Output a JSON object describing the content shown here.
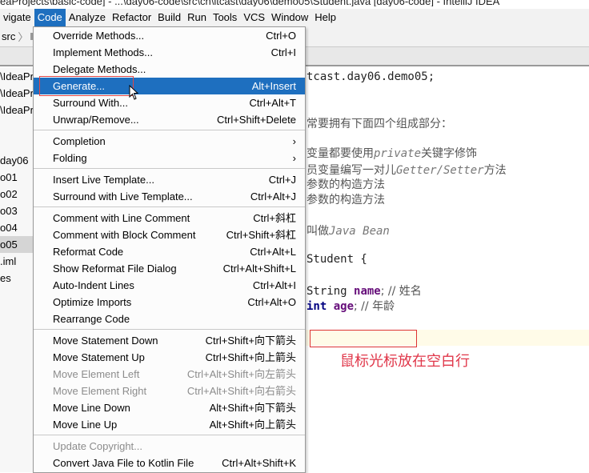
{
  "window_title": "eaProjects\\basic-code] - ...\\day06-code\\src\\cn\\itcast\\day06\\demo05\\Student.java [day06-code] - IntelliJ IDEA",
  "menubar": [
    "vigate",
    "Code",
    "Analyze",
    "Refactor",
    "Build",
    "Run",
    "Tools",
    "VCS",
    "Window",
    "Help"
  ],
  "navbar": {
    "crumb": "src"
  },
  "tree": [
    "\\IdeaPr",
    "\\IdeaPr",
    "\\IdeaPr",
    "",
    "",
    "day06",
    "o01",
    "o02",
    "o03",
    "o04",
    "o05",
    ".iml",
    "es"
  ],
  "menu": [
    {
      "label": "Override Methods...",
      "shortcut": "Ctrl+O"
    },
    {
      "label": "Implement Methods...",
      "shortcut": "Ctrl+I"
    },
    {
      "label": "Delegate Methods...",
      "shortcut": ""
    },
    {
      "label": "Generate...",
      "shortcut": "Alt+Insert",
      "highlighted": true
    },
    {
      "label": "Surround With...",
      "shortcut": "Ctrl+Alt+T"
    },
    {
      "label": "Unwrap/Remove...",
      "shortcut": "Ctrl+Shift+Delete"
    },
    {
      "sep": true
    },
    {
      "label": "Completion",
      "shortcut": "›"
    },
    {
      "label": "Folding",
      "shortcut": "›"
    },
    {
      "sep": true
    },
    {
      "label": "Insert Live Template...",
      "shortcut": "Ctrl+J"
    },
    {
      "label": "Surround with Live Template...",
      "shortcut": "Ctrl+Alt+J"
    },
    {
      "sep": true
    },
    {
      "label": "Comment with Line Comment",
      "shortcut": "Ctrl+斜杠"
    },
    {
      "label": "Comment with Block Comment",
      "shortcut": "Ctrl+Shift+斜杠"
    },
    {
      "label": "Reformat Code",
      "shortcut": "Ctrl+Alt+L"
    },
    {
      "label": "Show Reformat File Dialog",
      "shortcut": "Ctrl+Alt+Shift+L"
    },
    {
      "label": "Auto-Indent Lines",
      "shortcut": "Ctrl+Alt+I"
    },
    {
      "label": "Optimize Imports",
      "shortcut": "Ctrl+Alt+O"
    },
    {
      "label": "Rearrange Code",
      "shortcut": ""
    },
    {
      "sep": true
    },
    {
      "label": "Move Statement Down",
      "shortcut": "Ctrl+Shift+向下箭头"
    },
    {
      "label": "Move Statement Up",
      "shortcut": "Ctrl+Shift+向上箭头"
    },
    {
      "label": "Move Element Left",
      "shortcut": "Ctrl+Alt+Shift+向左箭头",
      "disabled": true
    },
    {
      "label": "Move Element Right",
      "shortcut": "Ctrl+Alt+Shift+向右箭头",
      "disabled": true
    },
    {
      "label": "Move Line Down",
      "shortcut": "Alt+Shift+向下箭头"
    },
    {
      "label": "Move Line Up",
      "shortcut": "Alt+Shift+向上箭头"
    },
    {
      "sep": true
    },
    {
      "label": "Update Copyright...",
      "shortcut": "",
      "disabled": true
    },
    {
      "label": "Convert Java File to Kotlin File",
      "shortcut": "Ctrl+Alt+Shift+K"
    }
  ],
  "code": {
    "package": "tcast.day06.demo05;",
    "c1": "常要拥有下面四个组成部分：",
    "c2a": "变量都要使用",
    "c2b": "private",
    "c2c": "关键字修饰",
    "c3a": "员变量编写一对儿",
    "c3b": "Getter/Setter",
    "c3c": "方法",
    "c4": "参数的构造方法",
    "c5": "参数的构造方法",
    "c6a": "叫做",
    "c6b": "Java Bean",
    "cls": " Student {",
    "f1a": "String ",
    "f1b": "name",
    "f1c": "; // 姓名",
    "f2a": "int ",
    "f2b": "age",
    "f2c": "; // 年龄"
  },
  "annotation": "鼠标光标放在空白行",
  "colors": {
    "accent": "#1e6fbf",
    "annotation": "#e0374a"
  }
}
